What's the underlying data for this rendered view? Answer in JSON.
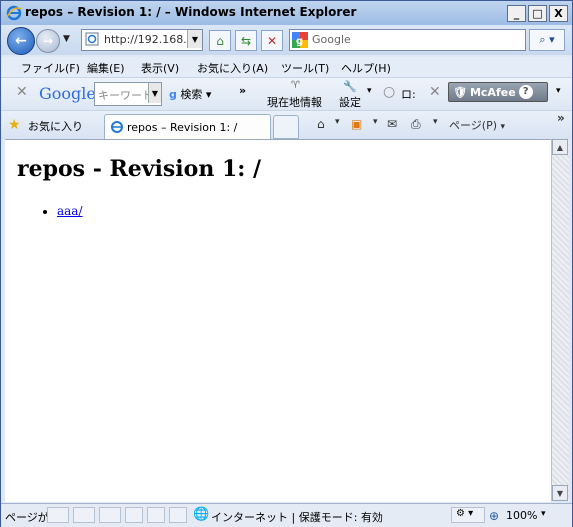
{
  "window": {
    "title": "repos – Revision 1: / – Windows Internet Explorer",
    "minimize_glyph": "_",
    "maximize_glyph": "□",
    "close_glyph": "X"
  },
  "address_bar": {
    "url": "http://192.168....",
    "search_placeholder": "Google"
  },
  "menu": {
    "items": [
      "ファイル(F)",
      "編集(E)",
      "表示(V)",
      "お気に入り(A)",
      "ツール(T)",
      "ヘルプ(H)"
    ]
  },
  "google_toolbar": {
    "logo": "Google",
    "keyword_placeholder": "キーワード",
    "search_label": "検索",
    "location_label": "現在地情報",
    "settings_label": "設定",
    "login_label": "ロ:",
    "mcafee_label": "McAfee"
  },
  "favorites_bar": {
    "favorites_label": "お気に入り",
    "tab_title": "repos – Revision 1: /",
    "page_menu_label": "ページ(P)"
  },
  "page": {
    "heading": "repos - Revision 1: /",
    "links": [
      "aaa/"
    ]
  },
  "status_bar": {
    "left_text": "ページが",
    "zone_text": "インターネット | 保護モード: 有効",
    "zoom_text": "100%"
  },
  "colors": {
    "link": "#0000ee",
    "titlebar": "#a8c3e8"
  }
}
